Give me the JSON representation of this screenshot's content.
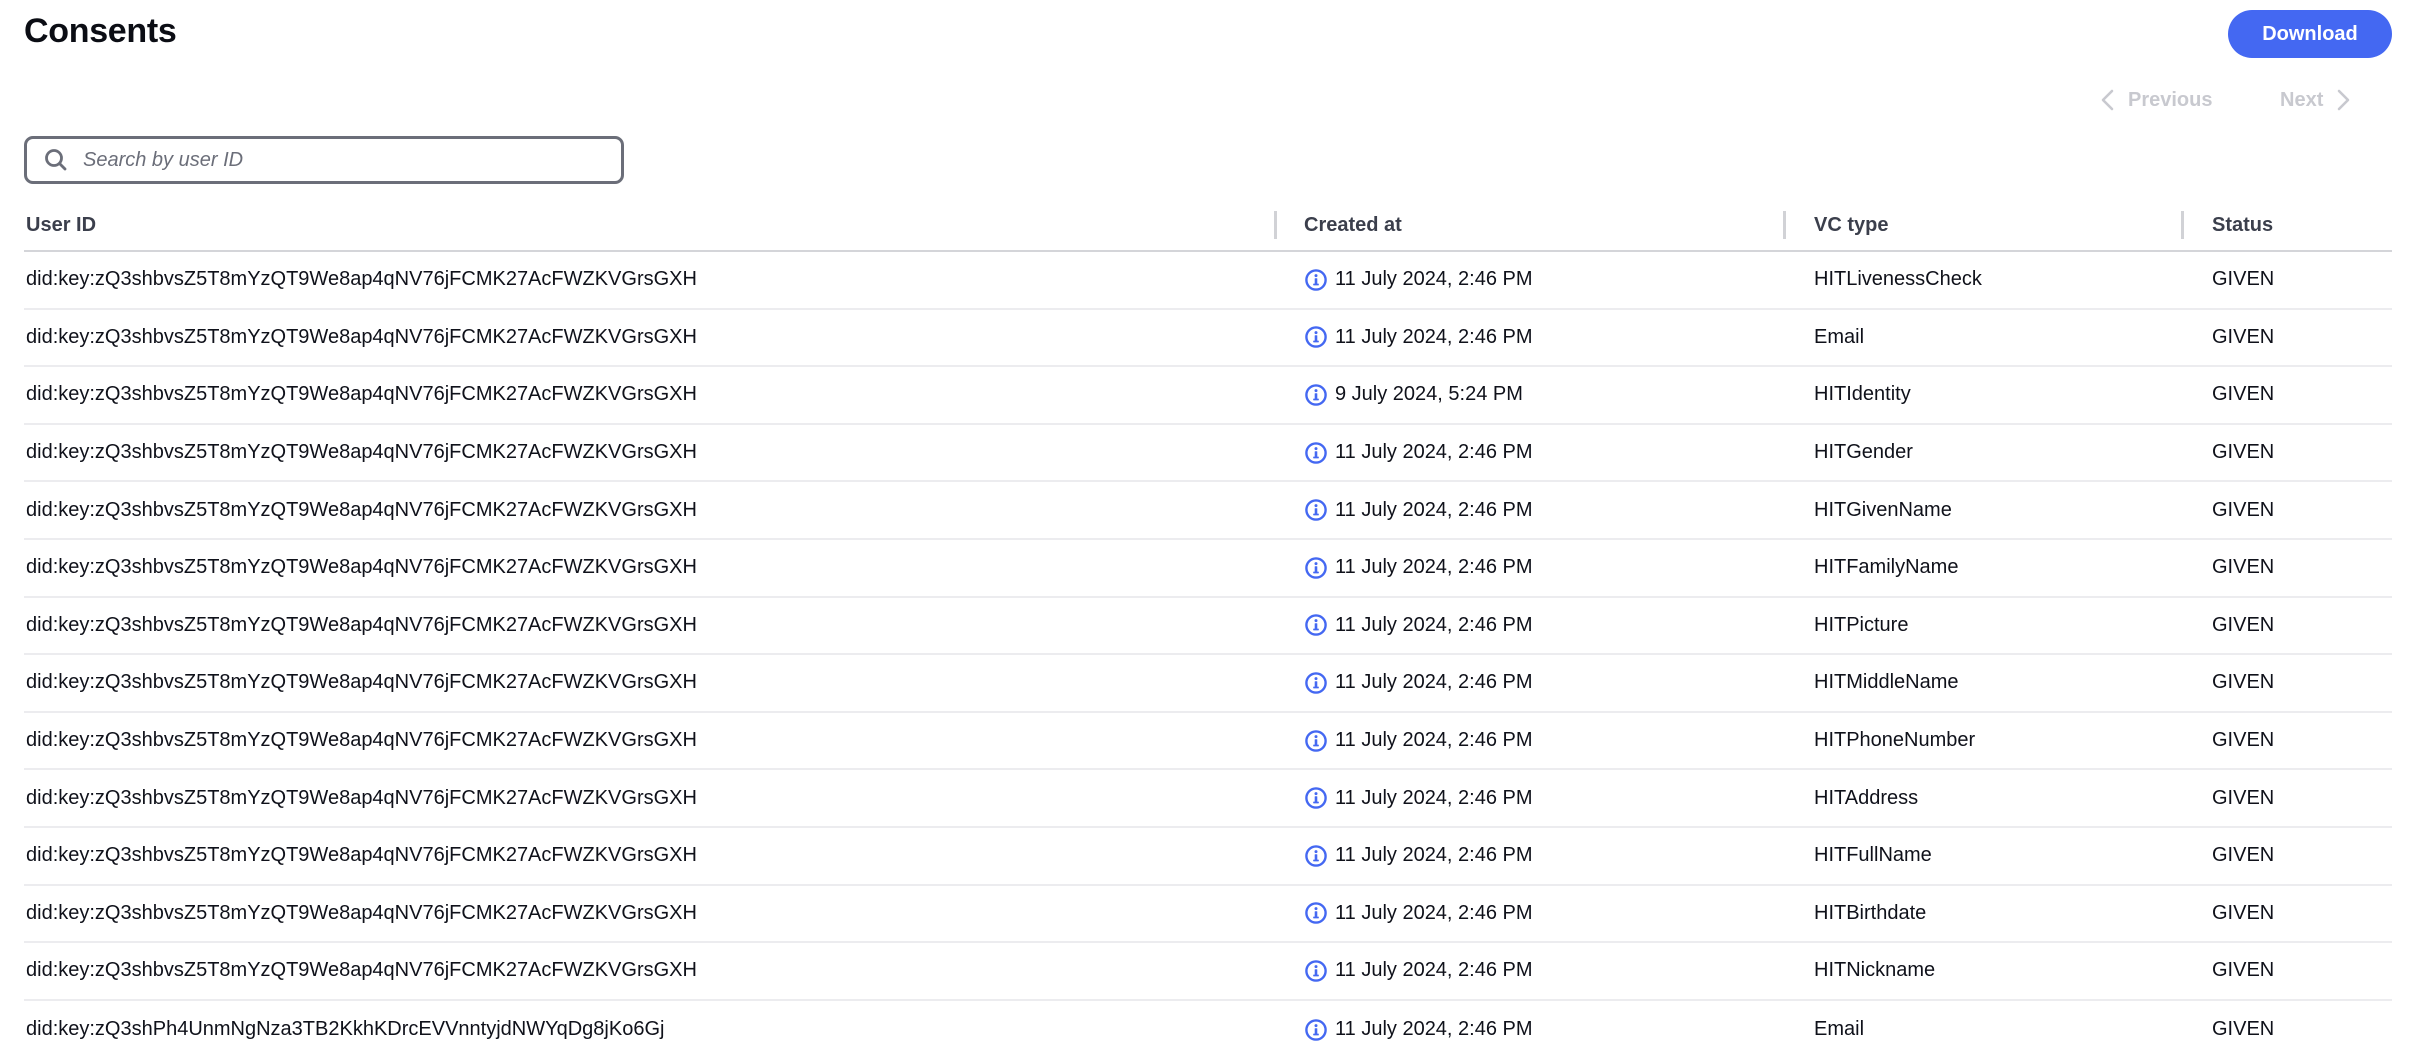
{
  "page": {
    "title": "Consents"
  },
  "toolbar": {
    "download_label": "Download",
    "previous_label": "Previous",
    "next_label": "Next"
  },
  "search": {
    "placeholder": "Search by user ID",
    "value": "",
    "icon": "search-icon"
  },
  "colors": {
    "accent": "#4468F2",
    "disabled_text": "#C8C9CF",
    "info_icon": "#4468F2"
  },
  "table": {
    "columns": [
      "User ID",
      "Created at",
      "VC type",
      "Status"
    ],
    "created_icon": "info-icon",
    "rows": [
      {
        "user_id": "did:key:zQ3shbvsZ5T8mYzQT9We8ap4qNV76jFCMK27AcFWZKVGrsGXH",
        "created_at": "11 July 2024, 2:46 PM",
        "vc_type": "HITLivenessCheck",
        "status": "GIVEN"
      },
      {
        "user_id": "did:key:zQ3shbvsZ5T8mYzQT9We8ap4qNV76jFCMK27AcFWZKVGrsGXH",
        "created_at": "11 July 2024, 2:46 PM",
        "vc_type": "Email",
        "status": "GIVEN"
      },
      {
        "user_id": "did:key:zQ3shbvsZ5T8mYzQT9We8ap4qNV76jFCMK27AcFWZKVGrsGXH",
        "created_at": "9 July 2024, 5:24 PM",
        "vc_type": "HITIdentity",
        "status": "GIVEN"
      },
      {
        "user_id": "did:key:zQ3shbvsZ5T8mYzQT9We8ap4qNV76jFCMK27AcFWZKVGrsGXH",
        "created_at": "11 July 2024, 2:46 PM",
        "vc_type": "HITGender",
        "status": "GIVEN"
      },
      {
        "user_id": "did:key:zQ3shbvsZ5T8mYzQT9We8ap4qNV76jFCMK27AcFWZKVGrsGXH",
        "created_at": "11 July 2024, 2:46 PM",
        "vc_type": "HITGivenName",
        "status": "GIVEN"
      },
      {
        "user_id": "did:key:zQ3shbvsZ5T8mYzQT9We8ap4qNV76jFCMK27AcFWZKVGrsGXH",
        "created_at": "11 July 2024, 2:46 PM",
        "vc_type": "HITFamilyName",
        "status": "GIVEN"
      },
      {
        "user_id": "did:key:zQ3shbvsZ5T8mYzQT9We8ap4qNV76jFCMK27AcFWZKVGrsGXH",
        "created_at": "11 July 2024, 2:46 PM",
        "vc_type": "HITPicture",
        "status": "GIVEN"
      },
      {
        "user_id": "did:key:zQ3shbvsZ5T8mYzQT9We8ap4qNV76jFCMK27AcFWZKVGrsGXH",
        "created_at": "11 July 2024, 2:46 PM",
        "vc_type": "HITMiddleName",
        "status": "GIVEN"
      },
      {
        "user_id": "did:key:zQ3shbvsZ5T8mYzQT9We8ap4qNV76jFCMK27AcFWZKVGrsGXH",
        "created_at": "11 July 2024, 2:46 PM",
        "vc_type": "HITPhoneNumber",
        "status": "GIVEN"
      },
      {
        "user_id": "did:key:zQ3shbvsZ5T8mYzQT9We8ap4qNV76jFCMK27AcFWZKVGrsGXH",
        "created_at": "11 July 2024, 2:46 PM",
        "vc_type": "HITAddress",
        "status": "GIVEN"
      },
      {
        "user_id": "did:key:zQ3shbvsZ5T8mYzQT9We8ap4qNV76jFCMK27AcFWZKVGrsGXH",
        "created_at": "11 July 2024, 2:46 PM",
        "vc_type": "HITFullName",
        "status": "GIVEN"
      },
      {
        "user_id": "did:key:zQ3shbvsZ5T8mYzQT9We8ap4qNV76jFCMK27AcFWZKVGrsGXH",
        "created_at": "11 July 2024, 2:46 PM",
        "vc_type": "HITBirthdate",
        "status": "GIVEN"
      },
      {
        "user_id": "did:key:zQ3shbvsZ5T8mYzQT9We8ap4qNV76jFCMK27AcFWZKVGrsGXH",
        "created_at": "11 July 2024, 2:46 PM",
        "vc_type": "HITNickname",
        "status": "GIVEN"
      },
      {
        "user_id": "did:key:zQ3shPh4UnmNgNza3TB2KkhKDrcEVVnntyjdNWYqDg8jKo6Gj",
        "created_at": "11 July 2024, 2:46 PM",
        "vc_type": "Email",
        "status": "GIVEN"
      }
    ]
  }
}
